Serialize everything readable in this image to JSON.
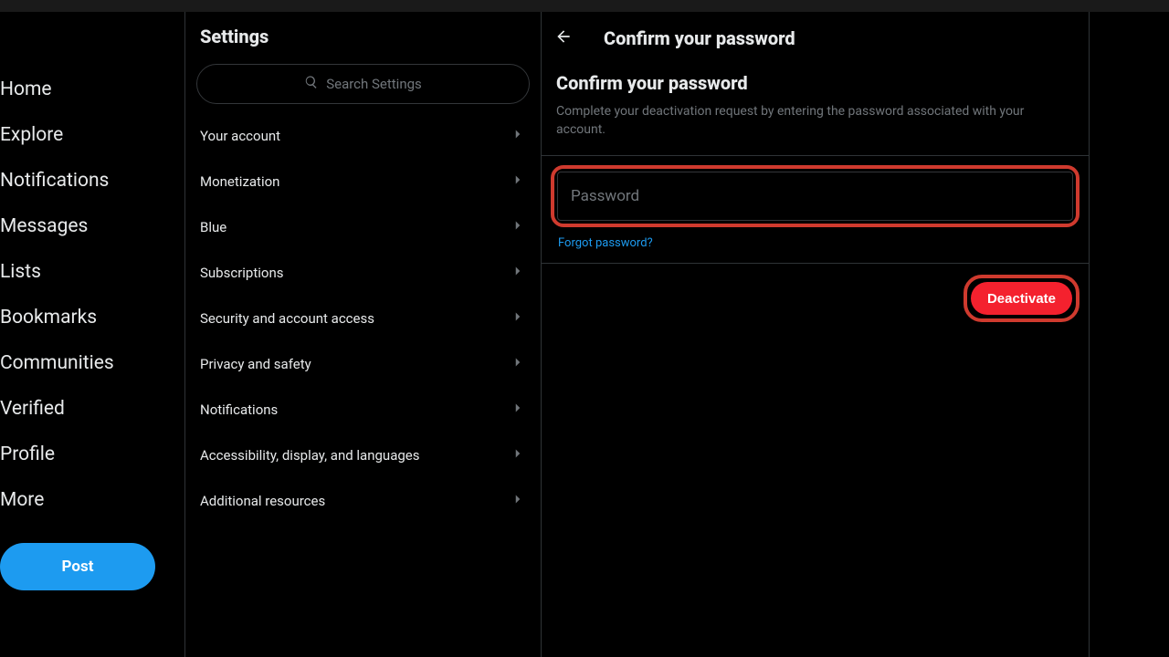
{
  "nav": {
    "items": [
      {
        "label": "Home"
      },
      {
        "label": "Explore"
      },
      {
        "label": "Notifications"
      },
      {
        "label": "Messages"
      },
      {
        "label": "Lists"
      },
      {
        "label": "Bookmarks"
      },
      {
        "label": "Communities"
      },
      {
        "label": "Verified"
      },
      {
        "label": "Profile"
      },
      {
        "label": "More"
      }
    ],
    "post_label": "Post"
  },
  "settings": {
    "title": "Settings",
    "search_placeholder": "Search Settings",
    "items": [
      {
        "label": "Your account"
      },
      {
        "label": "Monetization"
      },
      {
        "label": "Blue"
      },
      {
        "label": "Subscriptions"
      },
      {
        "label": "Security and account access"
      },
      {
        "label": "Privacy and safety"
      },
      {
        "label": "Notifications"
      },
      {
        "label": "Accessibility, display, and languages"
      },
      {
        "label": "Additional resources"
      }
    ]
  },
  "detail": {
    "header_title": "Confirm your password",
    "subtitle": "Confirm your password",
    "description": "Complete your deactivation request by entering the password associated with your account.",
    "password_placeholder": "Password",
    "forgot_label": "Forgot password?",
    "deactivate_label": "Deactivate"
  }
}
